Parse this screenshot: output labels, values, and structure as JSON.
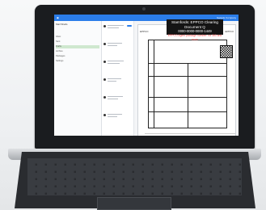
{
  "app": {
    "header_right": "Sample Company"
  },
  "sidebar": {
    "title": "Mail Shells",
    "rows": [
      "Inbox",
      "Sent",
      "Drafts",
      "Archive",
      "Packages",
      "Settings"
    ]
  },
  "document": {
    "banner_line1": "Stamfords: EPPCO Clearing Document Q",
    "banner_line2": "0000-0000-0000-1449",
    "banner_line3": "EPPCO Agent package number: na 360 and more",
    "brand": "EPPCO"
  },
  "colors": {
    "accent": "#2b7de9",
    "banner_bg": "#141414",
    "warning": "#ff4a4a",
    "bezel": "#1a1c1f"
  },
  "icons": [
    "camera-icon",
    "qr-code-icon",
    "avatar-icon"
  ]
}
